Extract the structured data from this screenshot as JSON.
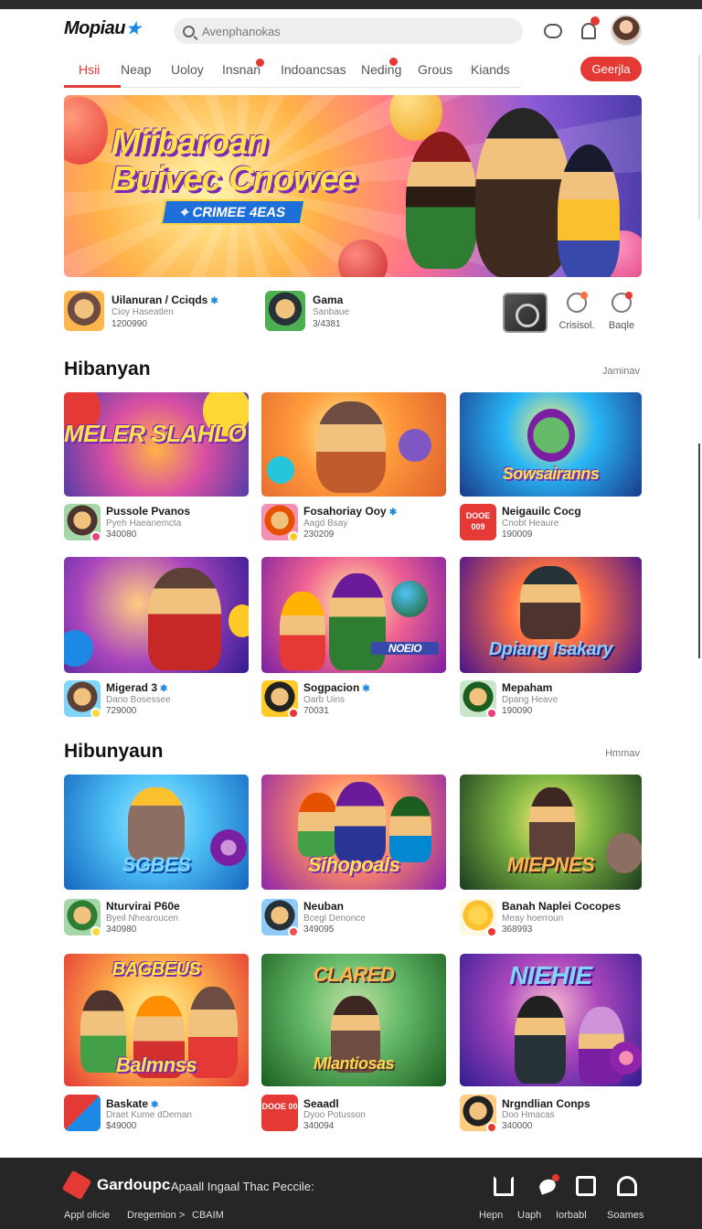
{
  "header": {
    "logo": "Mopiau",
    "logo_star": "★",
    "search_placeholder": "Avenphanokas"
  },
  "nav": {
    "items": [
      "Hsii",
      "Neap",
      "Uoloy",
      "Insnan",
      "Indoancsas",
      "Neding",
      "Grous",
      "Kiands"
    ],
    "active_index": 0,
    "button_label": "Geerjla",
    "accent_color": "#e53935"
  },
  "hero": {
    "title_line1": "Miibaroan",
    "title_line2": "Buivec Cnowee",
    "ribbon": "⌖ CRIMEE 4EAS"
  },
  "featured": [
    {
      "title": "Uilanuran / Cciqds",
      "sub": "Cioy Haseatlen",
      "num": "1200990",
      "verified": true
    },
    {
      "title": "Gama",
      "sub": "Sanbaue",
      "num": "3/4381",
      "verified": false
    }
  ],
  "featured_actions": [
    {
      "label": "Crisisol.",
      "icon": "chat-star-icon"
    },
    {
      "label": "Baqle",
      "icon": "compass-icon"
    }
  ],
  "sections": [
    {
      "title": "Hibanyan",
      "more": "Jaminav",
      "cards": [
        {
          "art": "MELER SLAHLOY",
          "title": "Pussole Pvanos",
          "sub": "Pyeh Haeanemcta",
          "num": "340080"
        },
        {
          "art": "",
          "title": "Fosahoriay Ooy",
          "sub": "Aagd Bsay",
          "num": "230209",
          "verified": true
        },
        {
          "art": "Sowsairanns",
          "title": "Neigauilc Cocg",
          "sub": "Cnobt Heaure",
          "num": "190009",
          "tile_text": "DOOE 009"
        },
        {
          "art": "",
          "title": "Migerad 3",
          "sub": "Dano Bosessee",
          "num": "729000",
          "verified": true
        },
        {
          "art": "NOEIO",
          "title": "Sogpacion",
          "sub": "Oarb Uins",
          "num": "70031",
          "verified": true
        },
        {
          "art": "Dpiang Isakary",
          "title": "Mepaham",
          "sub": "Dpang Heave",
          "num": "190090"
        }
      ]
    },
    {
      "title": "Hibunyaun",
      "more": "Hmmav",
      "cards": [
        {
          "art": "SGBES",
          "title": "Nturvirai P60e",
          "sub": "Byeil Nhearoucen",
          "num": "340980"
        },
        {
          "art": "Sihopoals",
          "title": "Neuban",
          "sub": "Bcegl Denonce",
          "num": "349095"
        },
        {
          "art": "MIEPNES",
          "title": "Banah Naplei Cocopes",
          "sub": "Meay hoerroun",
          "num": "368993"
        },
        {
          "art": "Balmnss",
          "art_top": "BAGBEUS",
          "title": "Baskate",
          "sub": "Draet Kume dDeman",
          "num": "$49000",
          "verified": true
        },
        {
          "art": "Mlantiosas",
          "art_top": "CLARED",
          "title": "Seaadl",
          "sub": "Dyoo Potusson",
          "num": "340094",
          "tile_text": "DOOE 00"
        },
        {
          "art": "",
          "art_top": "NIEHIE",
          "title": "Nrgndlian Conps",
          "sub": "Doo Hmacas",
          "num": "340000"
        }
      ]
    }
  ],
  "footer": {
    "brand": "Gardoupc",
    "tagline": "Apaall Ingaal Thac Peccile:",
    "links": [
      "Appl olicie",
      "Dregemion >",
      "CBAIM"
    ],
    "icons": [
      {
        "icon": "home-icon",
        "label": "Hepn"
      },
      {
        "icon": "bird-icon",
        "label": "Uaph"
      },
      {
        "icon": "inbox-icon",
        "label": "Iorbabl"
      },
      {
        "icon": "user-icon",
        "label": "Soames"
      }
    ]
  }
}
